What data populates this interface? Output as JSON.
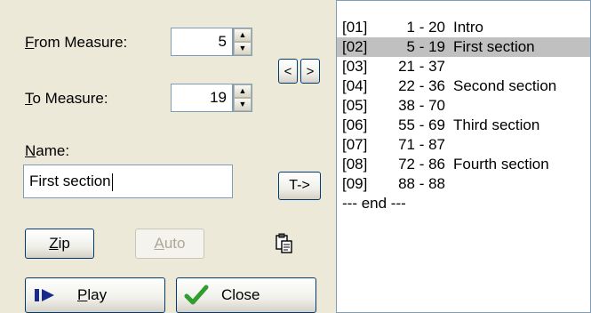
{
  "form": {
    "from_label_accel": "F",
    "from_label_rest": "rom Measure:",
    "from_value": "5",
    "to_label_accel": "T",
    "to_label_rest": "o Measure:",
    "to_value": "19",
    "name_label_accel": "N",
    "name_label_rest": "ame:",
    "name_value": "First section"
  },
  "nav": {
    "prev_glyph": "<",
    "next_glyph": ">",
    "copy_to_label": "T->"
  },
  "buttons": {
    "zip_accel": "Z",
    "zip_rest": "ip",
    "auto_accel": "A",
    "auto_rest": "uto",
    "play_accel": "P",
    "play_rest": "lay",
    "close_label": "Close"
  },
  "icons": {
    "paste": "paste-icon",
    "play": "play-icon",
    "check": "checkmark-icon",
    "spin_up": "spin-up-icon",
    "spin_down": "spin-down-icon"
  },
  "sections": {
    "selected_index": 1,
    "items": [
      {
        "id": "[01]",
        "range": "1 - 20",
        "name": "Intro"
      },
      {
        "id": "[02]",
        "range": "5 - 19",
        "name": "First section"
      },
      {
        "id": "[03]",
        "range": "21 - 37",
        "name": ""
      },
      {
        "id": "[04]",
        "range": "22 - 36",
        "name": "Second section"
      },
      {
        "id": "[05]",
        "range": "38 - 70",
        "name": ""
      },
      {
        "id": "[06]",
        "range": "55 - 69",
        "name": "Third section"
      },
      {
        "id": "[07]",
        "range": "71 - 87",
        "name": ""
      },
      {
        "id": "[08]",
        "range": "72 - 86",
        "name": "Fourth section"
      },
      {
        "id": "[09]",
        "range": "88 - 88",
        "name": ""
      }
    ],
    "end_marker": "--- end ---"
  },
  "colors": {
    "dialog_bg": "#ece9d8",
    "field_border": "#7f9db9",
    "selection_bg": "#c0c0c0",
    "button_border": "#003c74",
    "check_green": "#2f9e2f",
    "play_blue": "#1a2a8c"
  }
}
